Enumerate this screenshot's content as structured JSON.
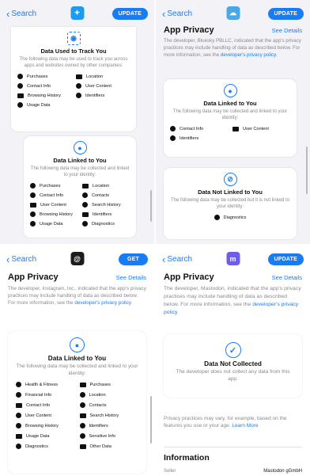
{
  "panel1": {
    "back_label": "Search",
    "app_icon_color": "#1d9bf0",
    "update_label": "UPDATE",
    "track_card": {
      "title": "Data Used to Track You",
      "desc": "The following data may be used to track you across apps and websites owned by other companies:",
      "items": [
        "Purchases",
        "Location",
        "Contact Info",
        "User Content",
        "Browsing History",
        "Identifiers",
        "Usage Data"
      ]
    },
    "linked_card": {
      "title": "Data Linked to You",
      "desc": "The following data may be collected and linked to your identity:",
      "items": [
        "Purchases",
        "Location",
        "Contact Info",
        "Contacts",
        "User Content",
        "Search History",
        "Browsing History",
        "Identifiers",
        "Usage Data",
        "Diagnostics"
      ]
    }
  },
  "panel2": {
    "back_label": "Search",
    "app_icon_color": "#48a8e8",
    "update_label": "UPDATE",
    "title": "App Privacy",
    "see_details": "See Details",
    "para_prefix": "The developer, ",
    "developer": "Bluesky PBLLC",
    "para_mid": ", indicated that the app's privacy practices may include handling of data as described below. For more information, see the ",
    "policy_link": "developer's privacy policy",
    "para_end": ".",
    "linked_card": {
      "title": "Data Linked to You",
      "desc": "The following data may be collected and linked to your identity:",
      "items": [
        "Contact Info",
        "User Content",
        "Identifiers"
      ]
    },
    "not_linked_card": {
      "title": "Data Not Linked to You",
      "desc": "The following data may be collected but it is not linked to your identity:",
      "items": [
        "Diagnostics"
      ]
    }
  },
  "panel3": {
    "back_label": "Search",
    "app_icon_color": "#1c1c1e",
    "get_label": "GET",
    "title": "App Privacy",
    "see_details": "See Details",
    "para_prefix": "The developer, ",
    "developer": "Instagram, Inc.",
    "para_mid": ", indicated that the app's privacy practices may include handling of data as described below. For more information, see the ",
    "policy_link": "developer's privacy policy",
    "para_end": ".",
    "linked_card": {
      "title": "Data Linked to You",
      "desc": "The following data may be collected and linked to your identity:",
      "items": [
        "Health & Fitness",
        "Purchases",
        "Financial Info",
        "Location",
        "Contact Info",
        "Contacts",
        "User Content",
        "Search History",
        "Browsing History",
        "Identifiers",
        "Usage Data",
        "Sensitive Info",
        "Diagnostics",
        "Other Data"
      ]
    }
  },
  "panel4": {
    "back_label": "Search",
    "app_icon_color": "#6d5ee8",
    "update_label": "UPDATE",
    "title": "App Privacy",
    "see_details": "See Details",
    "para_prefix": "The developer, ",
    "developer": "Mastodon",
    "para_mid": ", indicated that the app's privacy practices may include handling of data as described below. For more information, see the ",
    "policy_link": "developer's privacy policy",
    "para_end": ".",
    "not_collected_card": {
      "title": "Data Not Collected",
      "desc": "The developer does not collect any data from this app."
    },
    "footnote": "Privacy practices may vary, for example, based on the features you use or your age. ",
    "learn_more": "Learn More",
    "info_title": "Information",
    "seller_label": "Seller",
    "seller_value": "Mastodon gGmbH"
  }
}
